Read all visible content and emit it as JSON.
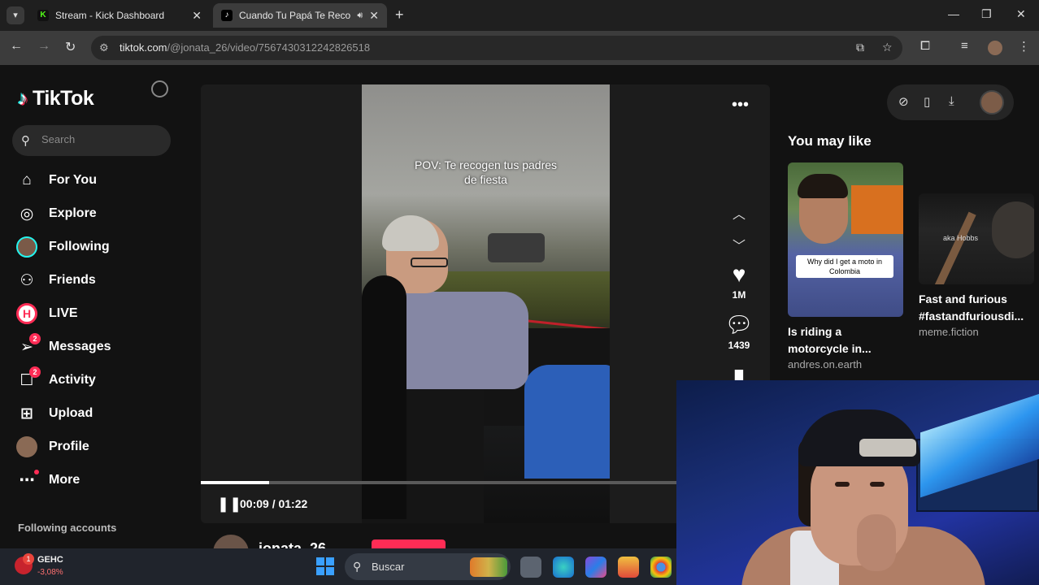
{
  "browser": {
    "tabs": [
      {
        "title": "Stream - Kick Dashboard",
        "favicon": "kick-logo",
        "active": false
      },
      {
        "title": "Cuando Tu Papá Te Recoge",
        "favicon": "tiktok-logo",
        "active": true
      }
    ],
    "url_host": "tiktok.com",
    "url_path": "/@jonata_26/video/7567430312242826518"
  },
  "tiktok": {
    "logo_text": "TikTok",
    "search_placeholder": "Search",
    "nav": [
      {
        "label": "For You",
        "icon": "home-icon"
      },
      {
        "label": "Explore",
        "icon": "compass-icon"
      },
      {
        "label": "Following",
        "icon": "following-avatar-icon"
      },
      {
        "label": "Friends",
        "icon": "friends-icon"
      },
      {
        "label": "LIVE",
        "icon": "live-icon"
      },
      {
        "label": "Messages",
        "icon": "messages-icon",
        "badge": "2"
      },
      {
        "label": "Activity",
        "icon": "activity-icon",
        "badge": "2"
      },
      {
        "label": "Upload",
        "icon": "upload-icon"
      },
      {
        "label": "Profile",
        "icon": "profile-avatar-icon"
      },
      {
        "label": "More",
        "icon": "more-icon"
      }
    ],
    "following_accounts_label": "Following accounts"
  },
  "video": {
    "caption_line1": "POV: Te recogen tus padres",
    "caption_line2": "de fiesta",
    "likes": "1M",
    "comments": "1439",
    "time": "00:09 / 01:22",
    "progress": 0.12,
    "author": "jonata_26"
  },
  "you_may_like": {
    "heading": "You may like",
    "items": [
      {
        "title": "Is riding a motorcycle in...",
        "author": "andres.on.earth",
        "thumb_text": "Why did I get a moto in Colombia"
      },
      {
        "title": "Fast and furious #fastandfuriousdi...",
        "author": "meme.fiction",
        "thumb_text": "aka Hobbs"
      }
    ]
  },
  "taskbar": {
    "stock_name": "GEHC",
    "stock_change": "-3,08%",
    "stock_badge": "1",
    "search_label": "Buscar"
  },
  "colors": {
    "tiktok_red": "#fe2c55",
    "tiktok_cyan": "#25f4ee",
    "kick_green": "#53fc18"
  }
}
